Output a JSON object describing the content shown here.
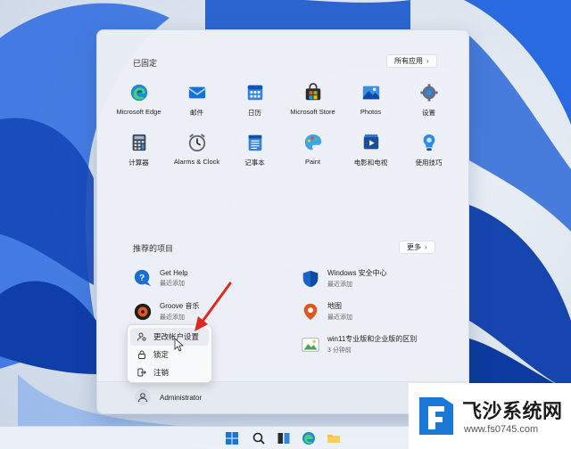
{
  "start_menu": {
    "pinned_title": "已固定",
    "all_apps_label": "所有应用",
    "pinned_apps": [
      {
        "label": "Microsoft Edge",
        "icon": "edge-icon"
      },
      {
        "label": "邮件",
        "icon": "mail-icon"
      },
      {
        "label": "日历",
        "icon": "calendar-icon"
      },
      {
        "label": "Microsoft Store",
        "icon": "store-icon"
      },
      {
        "label": "Photos",
        "icon": "photos-icon"
      },
      {
        "label": "设置",
        "icon": "settings-icon"
      },
      {
        "label": "计算器",
        "icon": "calculator-icon"
      },
      {
        "label": "Alarms & Clock",
        "icon": "clock-icon"
      },
      {
        "label": "记事本",
        "icon": "notepad-icon"
      },
      {
        "label": "Paint",
        "icon": "paint-icon"
      },
      {
        "label": "电影和电视",
        "icon": "movies-icon"
      },
      {
        "label": "使用技巧",
        "icon": "tips-icon"
      }
    ],
    "recommended_title": "推荐的项目",
    "more_label": "更多",
    "recommended": [
      {
        "name": "Get Help",
        "sub": "最近添加",
        "icon": "get-help-icon"
      },
      {
        "name": "Windows 安全中心",
        "sub": "最近添加",
        "icon": "windows-security-icon"
      },
      {
        "name": "Groove 音乐",
        "sub": "最近添加",
        "icon": "groove-music-icon"
      },
      {
        "name": "地图",
        "sub": "最近添加",
        "icon": "maps-icon"
      },
      {
        "name": "win11专业版和企业版的区别",
        "sub": "3 分钟前",
        "icon": "image-file-icon"
      }
    ],
    "user_name": "Administrator"
  },
  "context_menu": {
    "items": [
      {
        "label": "更改帐户设置",
        "icon": "account-settings-icon"
      },
      {
        "label": "锁定",
        "icon": "lock-icon"
      },
      {
        "label": "注销",
        "icon": "sign-out-icon"
      }
    ]
  },
  "watermark": {
    "title": "飞沙系统网",
    "url": "www.fs0745.com"
  },
  "colors": {
    "accent": "#0a5fc4",
    "arrow": "#e0281e",
    "wallpaper_blue": "#1f5fd6"
  }
}
